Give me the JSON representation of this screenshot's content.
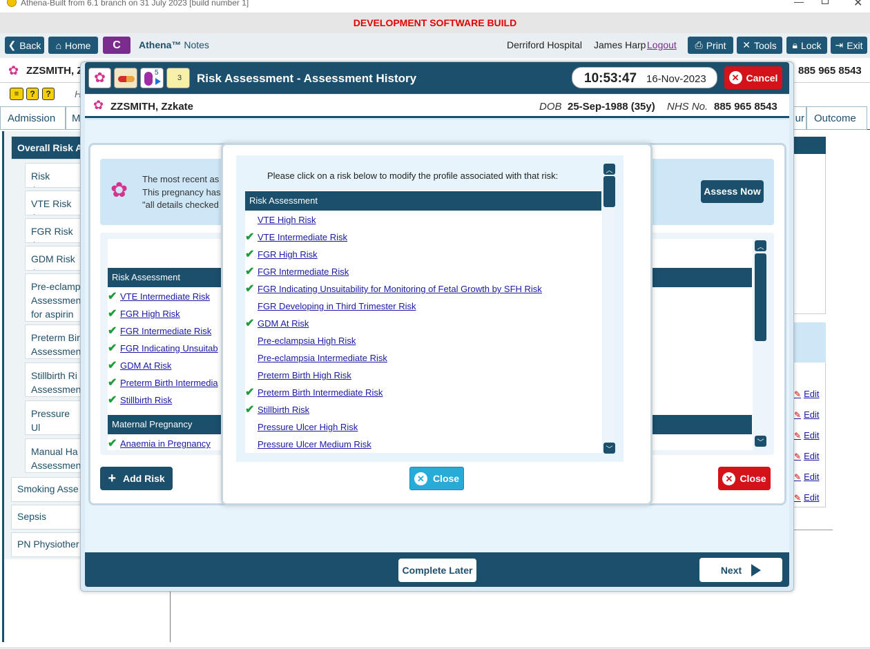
{
  "window": {
    "title": "Athena-Built from 6.1 branch on 31 July 2023 [build number 1]"
  },
  "banner": "DEVELOPMENT SOFTWARE BUILD",
  "toolbar": {
    "back": "Back",
    "home": "Home",
    "c_label": "C",
    "app_name": "Athena™",
    "app_sub": "Notes",
    "hospital": "Derriford Hospital",
    "user": "James Harp",
    "logout": "Logout",
    "print": "Print",
    "tools": "Tools",
    "lock": "Lock",
    "exit": "Exit"
  },
  "background": {
    "patient_name": "ZZSMITH, Z",
    "nhs_tail": "885 965 8543",
    "tab_admission": "Admission",
    "tab_m": "M",
    "tab_ur": "ur",
    "tab_outcome": "Outcome",
    "side_items": [
      "Overall Risk A",
      "Risk Assess",
      "VTE Risk As",
      "FGR Risk A",
      "GDM Risk A",
      "Pre-eclamp Assessmen for aspirin",
      "Preterm Bir Assessmen",
      "Stillbirth Ri Assessmen",
      "Pressure Ul Assessmen",
      "Manual Ha Assessmen",
      "Smoking Asse",
      "Sepsis",
      "PN Physiother"
    ],
    "edit_label": "Edit",
    "h_letter": "H"
  },
  "dialog": {
    "title": "Risk Assessment - Assessment History",
    "badge_count": "5",
    "note_count": "3",
    "time": "10:53:47",
    "date": "16-Nov-2023",
    "cancel": "Cancel",
    "patient": "ZZSMITH, Zzkate",
    "dob_label": "DOB",
    "dob_value": "25-Sep-1988 (35y)",
    "nhs_label": "NHS No.",
    "nhs_value": "885 965 8543",
    "info_line1": "The most recent as",
    "info_line2": "This pregnancy has",
    "info_line3": "\"all details checked",
    "assess_now": "Assess Now",
    "list_header": "Risk Assessment",
    "list_items": [
      {
        "label": "VTE Intermediate Risk",
        "checked": true
      },
      {
        "label": "FGR High Risk",
        "checked": true
      },
      {
        "label": "FGR Intermediate Risk",
        "checked": true
      },
      {
        "label": "FGR Indicating Unsuitab",
        "checked": true
      },
      {
        "label": "GDM At Risk",
        "checked": true
      },
      {
        "label": "Preterm Birth Intermedia",
        "checked": true
      },
      {
        "label": "Stillbirth Risk",
        "checked": true
      }
    ],
    "maternal_header": "Maternal Pregnancy",
    "maternal_items": [
      {
        "label": "Anaemia in Pregnancy",
        "checked": true
      }
    ],
    "add_risk": "Add Risk",
    "close": "Close",
    "complete_later": "Complete Later",
    "next": "Next"
  },
  "popup": {
    "instruction": "Please click on a risk below to modify the profile associated with that risk:",
    "header": "Risk Assessment",
    "items": [
      {
        "label": "VTE High Risk",
        "checked": false
      },
      {
        "label": "VTE Intermediate Risk",
        "checked": true
      },
      {
        "label": "FGR High Risk",
        "checked": true
      },
      {
        "label": "FGR Intermediate Risk",
        "checked": true
      },
      {
        "label": "FGR Indicating Unsuitability for Monitoring of Fetal Growth by SFH Risk",
        "checked": true
      },
      {
        "label": "FGR Developing in Third Trimester Risk",
        "checked": false
      },
      {
        "label": "GDM At Risk",
        "checked": true
      },
      {
        "label": "Pre-eclampsia High Risk",
        "checked": false
      },
      {
        "label": "Pre-eclampsia Intermediate Risk",
        "checked": false
      },
      {
        "label": "Preterm Birth High Risk",
        "checked": false
      },
      {
        "label": "Preterm Birth Intermediate Risk",
        "checked": true
      },
      {
        "label": "Stillbirth Risk",
        "checked": true
      },
      {
        "label": "Pressure Ulcer High Risk",
        "checked": false
      },
      {
        "label": "Pressure Ulcer Medium Risk",
        "checked": false
      }
    ],
    "close": "Close"
  }
}
